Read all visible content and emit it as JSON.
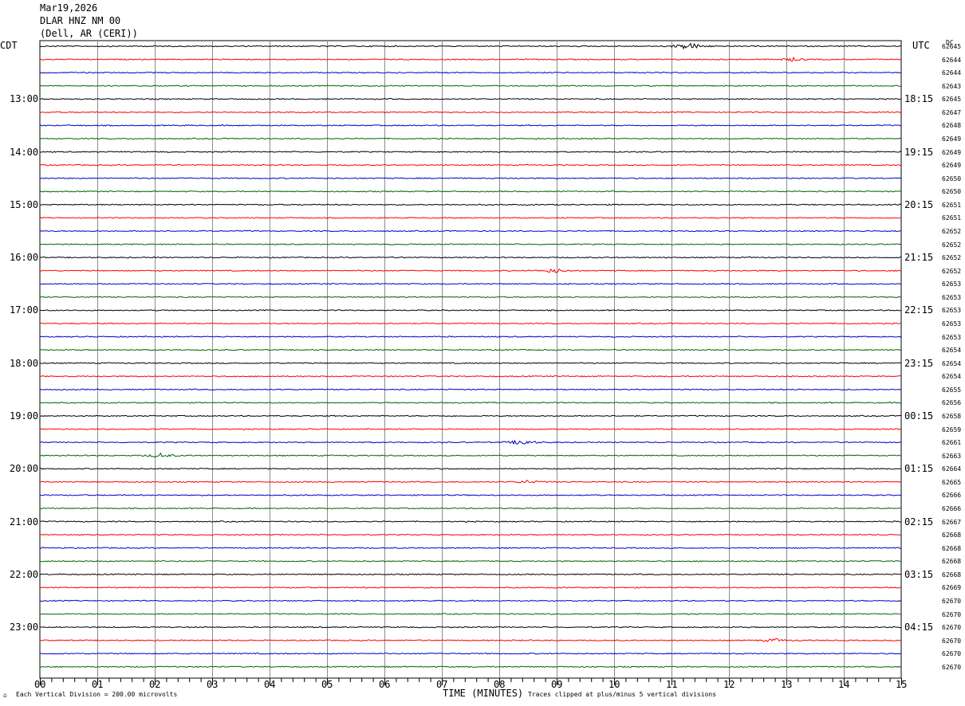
{
  "header": {
    "date": "Mar19,2026",
    "station": "DLAR HNZ NM 00",
    "location": "(Dell, AR (CERI))"
  },
  "left_zone_label": "CDT",
  "right_zone_label": "UTC",
  "dc_label": "DC",
  "chart_data": {
    "type": "line",
    "title": "",
    "xlabel": "TIME (MINUTES)",
    "x_ticks": [
      "00",
      "01",
      "02",
      "03",
      "04",
      "05",
      "06",
      "07",
      "08",
      "09",
      "10",
      "11",
      "12",
      "13",
      "14",
      "15"
    ],
    "xlim": [
      0,
      15
    ],
    "trace_colors": [
      "#000000",
      "#ff0000",
      "#0000cc",
      "#006600"
    ],
    "left_hour_labels": [
      "13:00",
      "14:00",
      "15:00",
      "16:00",
      "17:00",
      "18:00",
      "19:00",
      "20:00",
      "21:00",
      "22:00",
      "23:00"
    ],
    "right_hour_labels": [
      "18:15",
      "19:15",
      "20:15",
      "21:15",
      "22:15",
      "23:15",
      "00:15",
      "01:15",
      "02:15",
      "03:15",
      "04:15"
    ],
    "dc_offsets": [
      "62645",
      "62644",
      "62644",
      "62643",
      "62645",
      "62647",
      "62648",
      "62649",
      "62649",
      "62649",
      "62650",
      "62650",
      "62651",
      "62651",
      "62652",
      "62652",
      "62652",
      "62652",
      "62653",
      "62653",
      "62653",
      "62653",
      "62653",
      "62654",
      "62654",
      "62654",
      "62655",
      "62656",
      "62658",
      "62659",
      "62661",
      "62663",
      "62664",
      "62665",
      "62666",
      "62666",
      "62667",
      "62668",
      "62668",
      "62668",
      "62668",
      "62669",
      "62670",
      "62670",
      "62670",
      "62670",
      "62670",
      "62670"
    ],
    "events": [
      {
        "trace": 0,
        "minute": 11.3,
        "amplitude": 5
      },
      {
        "trace": 1,
        "minute": 13.1,
        "amplitude": 2
      },
      {
        "trace": 17,
        "minute": 8.95,
        "amplitude": 3
      },
      {
        "trace": 30,
        "minute": 8.4,
        "amplitude": 4
      },
      {
        "trace": 31,
        "minute": 2.1,
        "amplitude": 3
      },
      {
        "trace": 33,
        "minute": 8.5,
        "amplitude": 2
      },
      {
        "trace": 45,
        "minute": 12.8,
        "amplitude": 2
      }
    ]
  },
  "footer": {
    "scale_note": "Each Vertical Division =  200.00 microvolts",
    "clip_note": "Traces clipped at plus/minus 5 vertical divisions"
  }
}
